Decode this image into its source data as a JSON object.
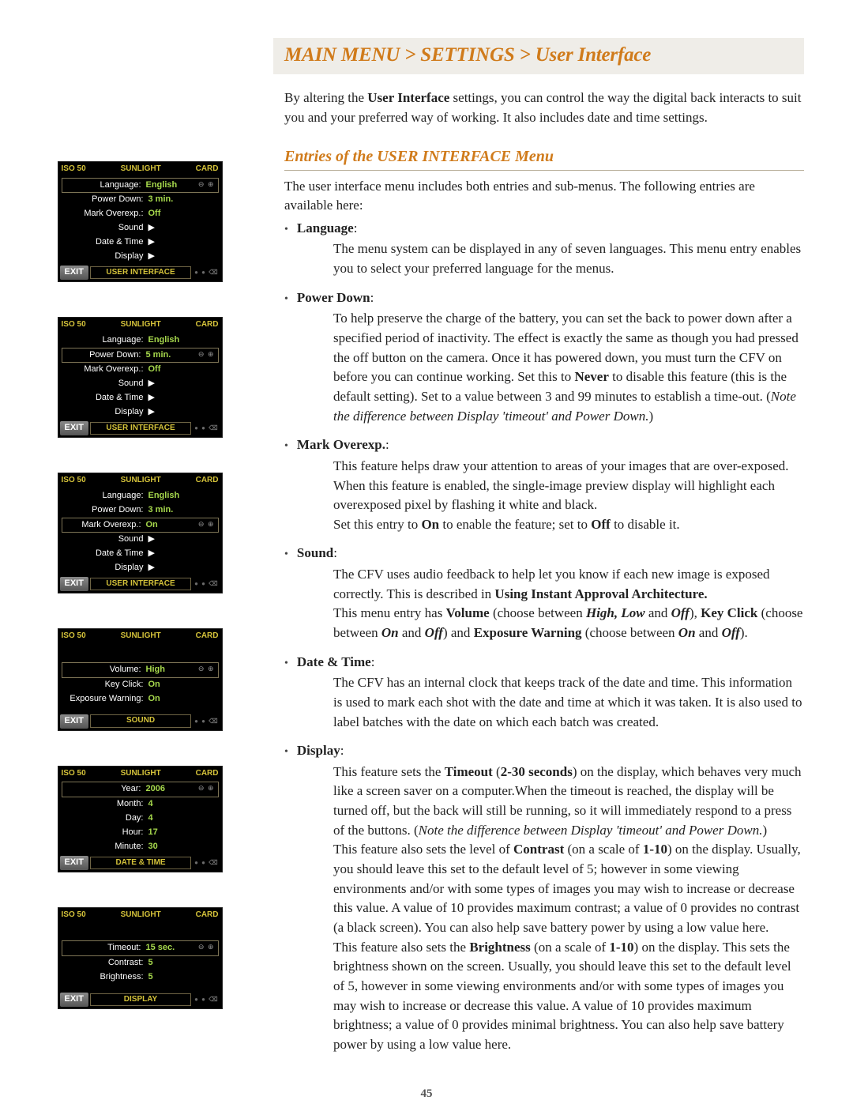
{
  "breadcrumb": "MAIN MENU > SETTINGS > User Interface",
  "intro_html": "By altering the <b>User Interface</b> settings, you can control the way the digital back interacts to suit you and your preferred way of working. It also includes date and time settings.",
  "section_heading": "Entries of the USER INTERFACE Menu",
  "section_intro": "The user interface menu includes both entries and sub-menus. The following entries are available here:",
  "entries": [
    {
      "label": "Language",
      "desc_html": "The menu system can be displayed in any of seven languages. This menu entry enables you to select your preferred language for the menus."
    },
    {
      "label": "Power Down",
      "desc_html": "To help preserve the charge of the battery, you can set the back to power down after a specified period of inactivity. The effect is exactly the same as though you had pressed the off button on the camera. Once it has powered down, you must turn the CFV on before you can continue working. Set this to <b>Never</b> to disable this feature (this is the default setting). Set to a value between 3 and 99 minutes to establish a time-out. (<i>Note the difference between Display 'timeout' and Power Down.</i>)"
    },
    {
      "label": "Mark Overexp.",
      "desc_html": "This feature helps draw your attention to areas of your images that are over-exposed. When this feature is enabled, the single-image preview display will highlight each overexposed pixel by flashing it white and black.<br>Set this entry to <b>On</b> to enable the feature; set to <b>Off</b> to disable it."
    },
    {
      "label": "Sound",
      "desc_html": "The CFV uses audio feedback to help let you know if each new image is exposed correctly. This is described in <b>Using Instant Approval Architecture.</b><br>This menu entry has <b>Volume</b> (choose between <span class='bi'>High, Low</span> and <span class='bi'>Off</span>), <b>Key Click</b> (choose between <span class='bi'>On</span> and <span class='bi'>Off</span>) and <b>Exposure Warning</b> (choose between <span class='bi'>On</span> and <span class='bi'>Off</span>)."
    },
    {
      "label": "Date & Time",
      "desc_html": "The CFV has an internal clock that keeps track of the date and time. This information is used to mark each shot with the date and time at which it was taken. It is also used to label batches with the date on which each batch was created."
    },
    {
      "label": "Display",
      "desc_html": "This feature sets the <b>Timeout</b> (<b>2-30 seconds</b>) on the display, which behaves very much like a screen saver on a computer.When the timeout is reached, the display will be turned off, but the back will still be running, so it will immediately respond to a press of the buttons. (<i>Note the difference between Display 'timeout' and Power Down.</i>)<br>This feature also sets the level of <b>Contrast</b> (on a scale of <b>1-10</b>) on the display. Usually, you should leave this set to the default level of 5; however in some viewing environments and/or with some types of images you may wish to increase or decrease this value. A value of 10 provides maximum contrast; a value of 0 provides no contrast (a black screen). You can also help save battery power by using a low value here.<br>This feature also sets the <b>Brightness</b> (on a scale of <b>1-10</b>) on the display. This sets the brightness shown on the screen. Usually, you should leave this set to the default level of 5, however in some viewing environments and/or with some types of images you may wish to increase or decrease this value. A value of 10 provides maximum brightness; a value of 0 provides minimal brightness. You can also help save battery power by using a low value here."
    }
  ],
  "page_number": "45",
  "screens": {
    "common": {
      "iso": "ISO 50",
      "sunlight": "SUNLIGHT",
      "card": "CARD",
      "exit": "EXIT",
      "plusminus": "⊖ ⊕",
      "icons": "● ● ⌫",
      "arrow": "▶"
    },
    "s1": {
      "title": "USER INTERFACE",
      "rows": [
        {
          "k": "Language:",
          "v": "English",
          "sel": true,
          "pm": true
        },
        {
          "k": "Power Down:",
          "v": "3 min."
        },
        {
          "k": "Mark Overexp.:",
          "v": "Off"
        },
        {
          "k": "Sound",
          "arrow": true
        },
        {
          "k": "Date & Time",
          "arrow": true
        },
        {
          "k": "Display",
          "arrow": true
        }
      ]
    },
    "s2": {
      "title": "USER INTERFACE",
      "rows": [
        {
          "k": "Language:",
          "v": "English"
        },
        {
          "k": "Power Down:",
          "v": "5 min.",
          "sel": true,
          "pm": true
        },
        {
          "k": "Mark Overexp.:",
          "v": "Off"
        },
        {
          "k": "Sound",
          "arrow": true
        },
        {
          "k": "Date & Time",
          "arrow": true
        },
        {
          "k": "Display",
          "arrow": true
        }
      ]
    },
    "s3": {
      "title": "USER INTERFACE",
      "rows": [
        {
          "k": "Language:",
          "v": "English"
        },
        {
          "k": "Power Down:",
          "v": "3 min."
        },
        {
          "k": "Mark Overexp.:",
          "v": "On",
          "sel": true,
          "pm": true
        },
        {
          "k": "Sound",
          "arrow": true
        },
        {
          "k": "Date & Time",
          "arrow": true
        },
        {
          "k": "Display",
          "arrow": true
        }
      ]
    },
    "s4": {
      "title": "SOUND",
      "rows": [
        {
          "k": "Volume:",
          "v": "High",
          "sel": true,
          "pm": true
        },
        {
          "k": "Key Click:",
          "v": "On"
        },
        {
          "k": "Exposure Warning:",
          "v": "On"
        }
      ],
      "padTop": true
    },
    "s5": {
      "title": "DATE & TIME",
      "rows": [
        {
          "k": "Year:",
          "v": "2006",
          "sel": true,
          "pm": true
        },
        {
          "k": "Month:",
          "v": "4"
        },
        {
          "k": "Day:",
          "v": "4"
        },
        {
          "k": "Hour:",
          "v": "17"
        },
        {
          "k": "Minute:",
          "v": "30"
        }
      ]
    },
    "s6": {
      "title": "DISPLAY",
      "rows": [
        {
          "k": "Timeout:",
          "v": "15 sec.",
          "sel": true,
          "pm": true
        },
        {
          "k": "Contrast:",
          "v": "5"
        },
        {
          "k": "Brightness:",
          "v": "5"
        }
      ],
      "padTop": true
    }
  }
}
